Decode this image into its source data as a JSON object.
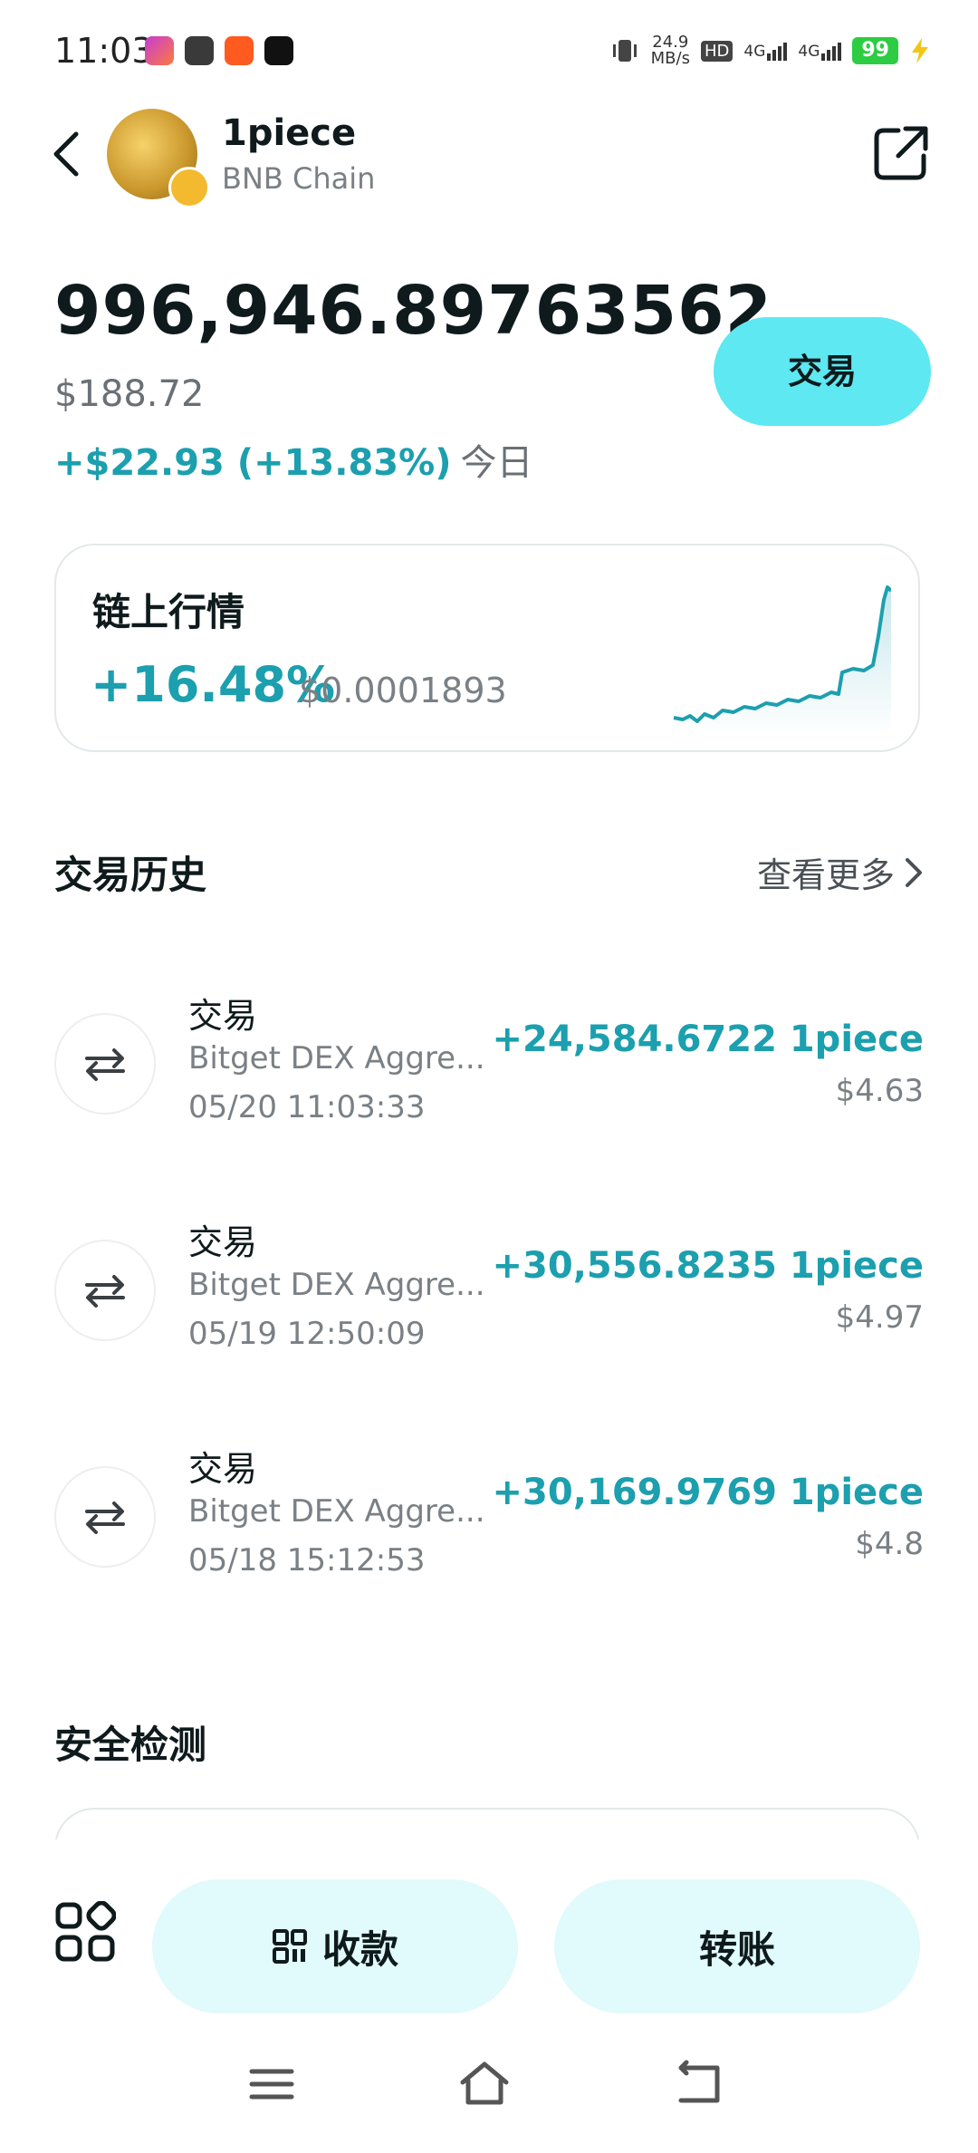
{
  "status_bar": {
    "time": "11:03",
    "net_speed_value": "24.9",
    "net_speed_unit": "MB/s",
    "hd_label": "HD",
    "net1": "4G",
    "net2": "4G",
    "battery": "99"
  },
  "header": {
    "token_name": "1piece",
    "chain": "BNB Chain"
  },
  "balance": {
    "amount": "996,946.89763562",
    "usd": "$188.72",
    "change": "+$22.93 (+13.83%)",
    "change_period": "今日",
    "trade_label": "交易"
  },
  "market": {
    "title": "链上行情",
    "change_pct": "+16.48%",
    "price": "$0.0001893",
    "accent_color": "#1c9fae"
  },
  "history": {
    "title": "交易历史",
    "see_more": "查看更多",
    "items": [
      {
        "type": "交易",
        "source": "Bitget DEX Aggre...",
        "time": "05/20 11:03:33",
        "amount": "+24,584.6722 1piece",
        "value": "$4.63"
      },
      {
        "type": "交易",
        "source": "Bitget DEX Aggre...",
        "time": "05/19 12:50:09",
        "amount": "+30,556.8235 1piece",
        "value": "$4.97"
      },
      {
        "type": "交易",
        "source": "Bitget DEX Aggre...",
        "time": "05/18 15:12:53",
        "amount": "+30,169.9769 1piece",
        "value": "$4.8"
      }
    ]
  },
  "security": {
    "title": "安全检测"
  },
  "actions": {
    "receive_label": "收款",
    "transfer_label": "转账"
  },
  "icons": {
    "back": "chevron-left-icon",
    "share": "share-icon",
    "swap": "swap-icon",
    "apps": "apps-grid-icon",
    "qr": "qr-code-icon",
    "nav_menu": "menu-icon",
    "nav_home": "home-icon",
    "nav_back": "back-icon"
  }
}
